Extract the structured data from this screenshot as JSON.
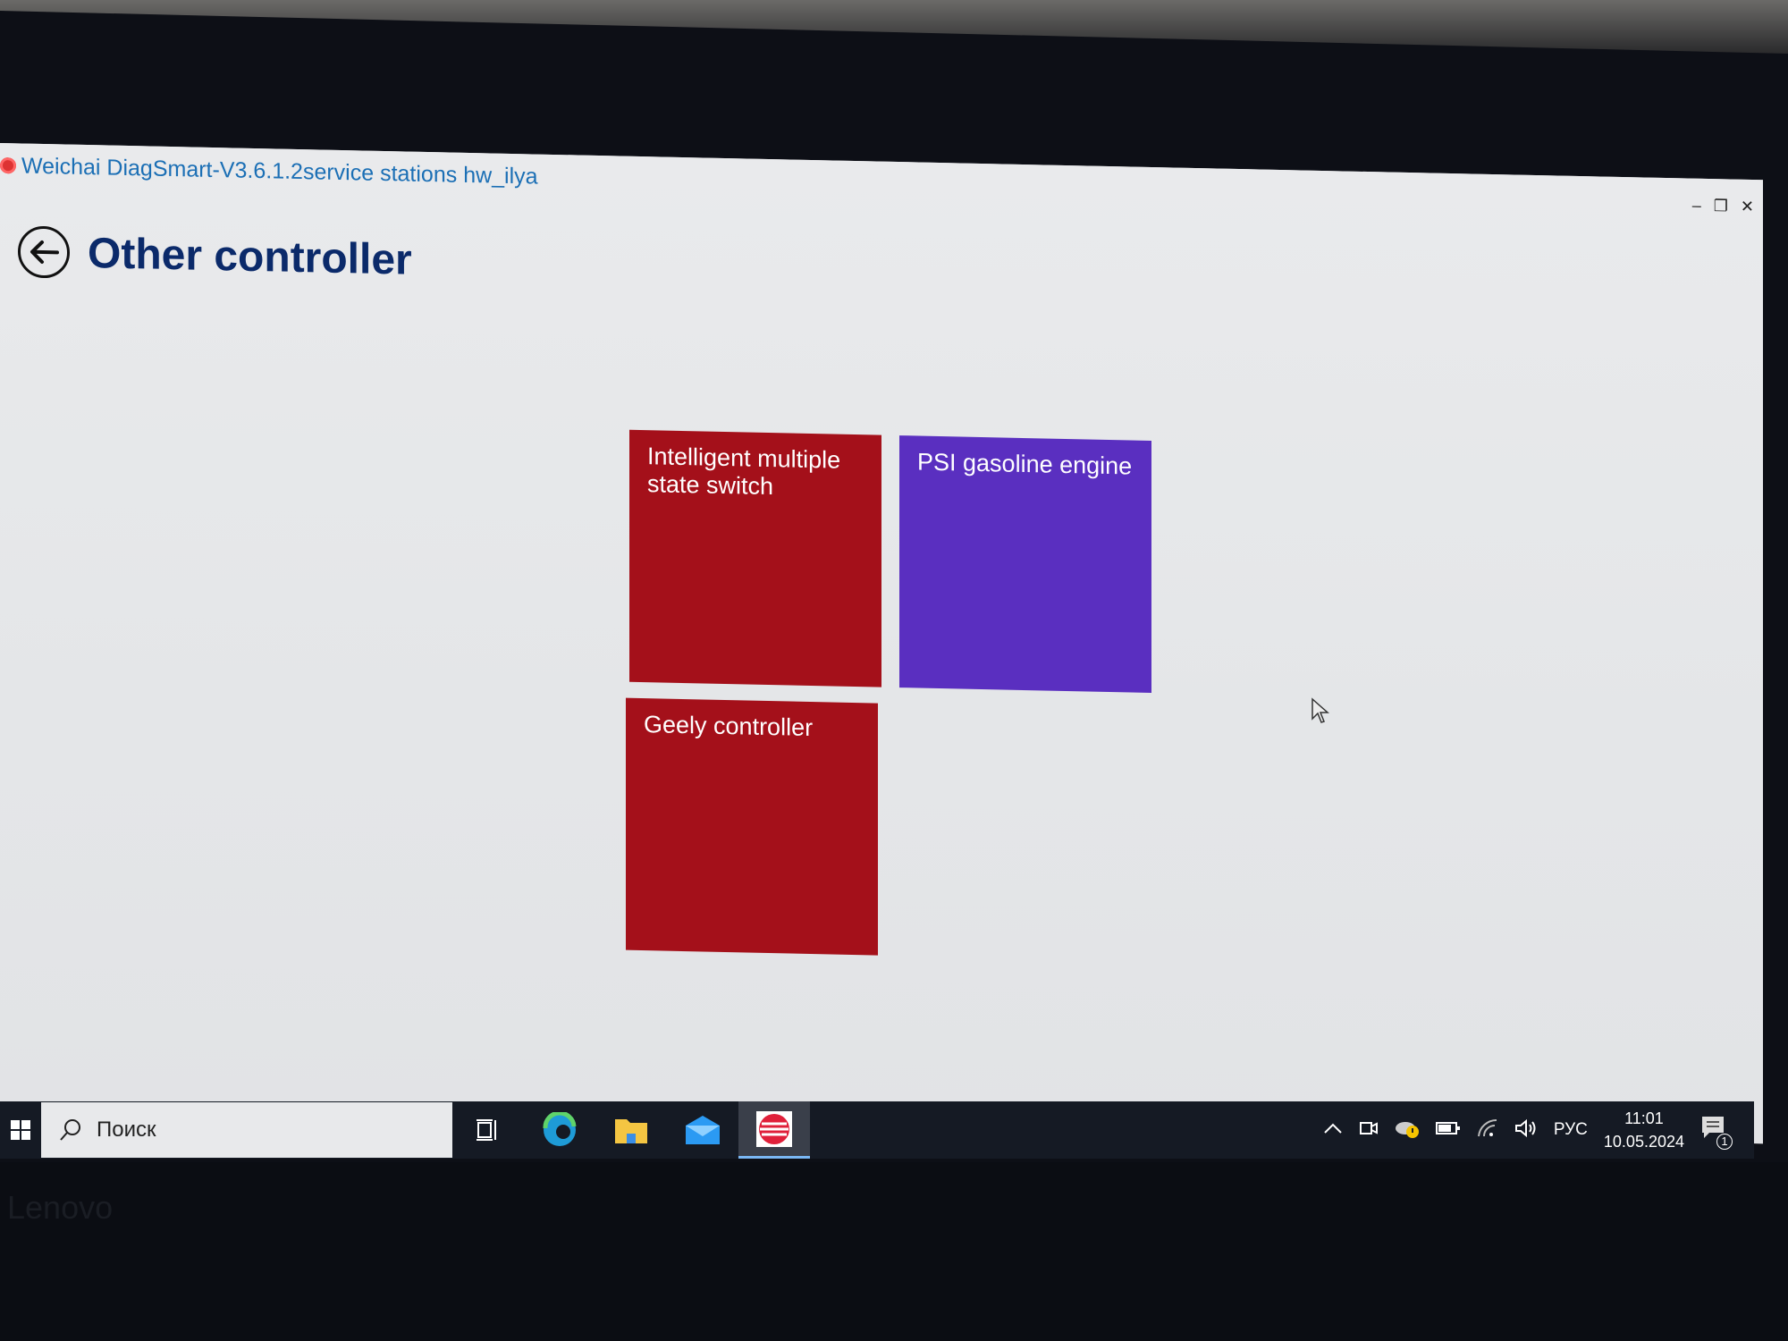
{
  "window": {
    "title": "Weichai DiagSmart-V3.6.1.2service stations hw_ilya",
    "controls": {
      "minimize": "–",
      "restore": "❐",
      "close": "✕"
    }
  },
  "page": {
    "title": "Other controller",
    "back_icon": "arrow-left-circle-icon"
  },
  "tiles": [
    {
      "label": "Intelligent multiple state switch",
      "color": "#a4101a"
    },
    {
      "label": "PSI gasoline engine",
      "color": "#5a2fc0"
    },
    {
      "label": "Geely controller",
      "color": "#a4101a"
    }
  ],
  "taskbar": {
    "search_placeholder": "Поиск",
    "apps": [
      "task-view",
      "edge",
      "file-explorer",
      "mail",
      "diagsmart"
    ],
    "tray": {
      "language": "РУС",
      "time": "11:01",
      "date": "10.05.2024",
      "notification_count": "1"
    }
  },
  "bezel": {
    "brand": "Lenovo"
  }
}
